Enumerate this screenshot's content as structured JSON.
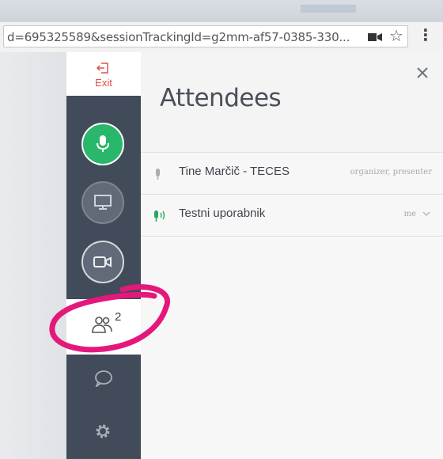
{
  "browser": {
    "url": "d=695325589&sessionTrackingId=g2mm-af57-0385-330...",
    "icons": [
      "camera-icon",
      "star-icon",
      "menu-icon"
    ]
  },
  "sidebar": {
    "exit_label": "Exit",
    "buttons": [
      {
        "name": "microphone",
        "state": "active",
        "color": "#29b76b"
      },
      {
        "name": "screen-share",
        "state": "inactive"
      },
      {
        "name": "webcam",
        "state": "inactive"
      }
    ],
    "attendees_count": "2",
    "accent_exit": "#e0504a"
  },
  "panel": {
    "title": "Attendees",
    "attendees": [
      {
        "name": "Tine Marčič - TECES",
        "role": "organizer, presenter",
        "audio": "muted"
      },
      {
        "name": "Testni uporabnik",
        "role": "me",
        "audio": "speaking"
      }
    ]
  },
  "colors": {
    "sidebar": "#424b5a",
    "mic_active": "#29b76b",
    "annotation": "#e4187b"
  }
}
